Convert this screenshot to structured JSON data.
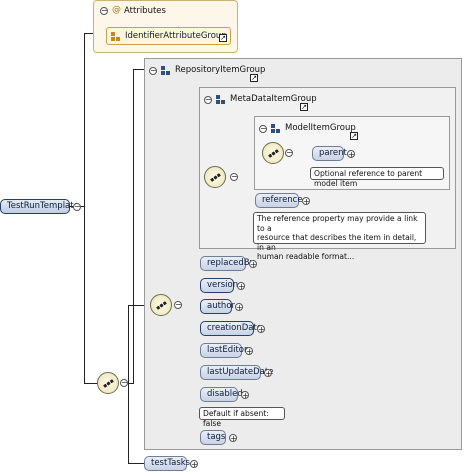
{
  "attributes": {
    "title": "Attributes",
    "group_ref": "IdentifierAttributeGroup"
  },
  "root": {
    "label": "TestRunTemplate"
  },
  "repository_group": {
    "title": "RepositoryItemGroup"
  },
  "metadata_group": {
    "title": "MetaDataItemGroup"
  },
  "model_group": {
    "title": "ModelItemGroup"
  },
  "parent": {
    "label": "parent",
    "doc": "Optional reference to parent model item"
  },
  "reference": {
    "label": "reference",
    "doc": [
      "The reference property may provide a link to a",
      "resource that describes the item in detail, in an",
      "human readable format..."
    ]
  },
  "elements": {
    "replacedBy": "replacedBy",
    "version": "version",
    "author": "author",
    "creationDate": "creationDate",
    "lastEditor": "lastEditor",
    "lastUpdateDate": "lastUpdateDate",
    "disabled": "disabled",
    "disabled_doc": "Default if absent: false",
    "tags": "tags",
    "testTasks": "testTasks"
  },
  "symbols": {
    "plus": "+",
    "minus": "−",
    "link": "↗"
  }
}
